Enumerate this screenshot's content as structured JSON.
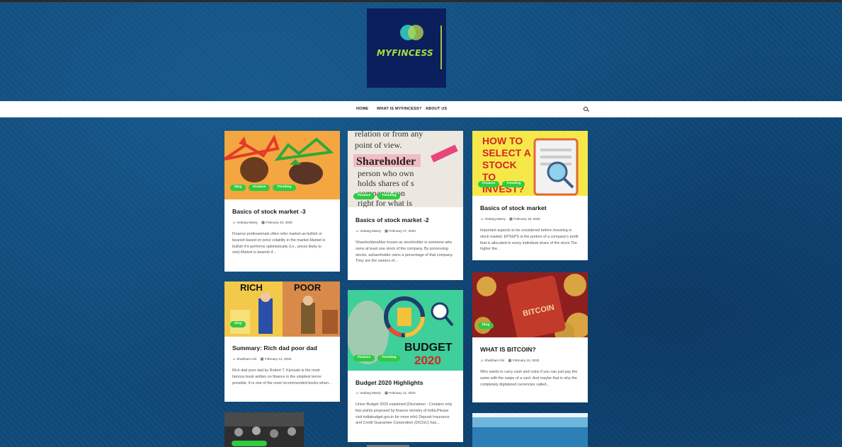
{
  "logo": {
    "text": "MYFINCESS"
  },
  "nav": {
    "items": [
      "HOME",
      "WHAT IS MYFINCESS?",
      "ABOUT US"
    ]
  },
  "posts": [
    {
      "title": "Basics of stock market -3",
      "author": "Vedang Marey",
      "date": "February 23, 2020",
      "tags": [
        "blog",
        "Finance",
        "Trending"
      ],
      "excerpt": "Finance professionals often refer market as bullish or bearish based on price volatility in the market.Market is bullish if it performs optimistically (i.e., prices likely to rise).Market is bearish if...",
      "thumb_colors": [
        "#f4a641",
        "#e6923a"
      ]
    },
    {
      "title": "Basics of stock market -2",
      "author": "Vedang Marey",
      "date": "February 17, 2020",
      "tags": [
        "Finance",
        "Trending"
      ],
      "excerpt": "ShareholdersAlso known as stockholder is someone who owns at least one stock of the company. By processing stocks, ashareholder owns a percentage of that company. They are the owners of...",
      "thumb_colors": [
        "#e9e6df",
        "#d9d4ca"
      ]
    },
    {
      "title": "Basics of stock market",
      "author": "Vedang Marey",
      "date": "February 16, 2020",
      "tags": [
        "Finance",
        "Trending"
      ],
      "excerpt": "Important aspects to be considered before investing in stock market: EPSEPS is the portion of a company's profit that is allocated to every individual share of the stock.The higher the...",
      "thumb_colors": [
        "#f7e84a",
        "#f2d630"
      ]
    },
    {
      "title": "Summary: Rich dad poor dad",
      "author": "Shubham Giri",
      "date": "February 12, 2020",
      "tags": [
        "blog"
      ],
      "excerpt": "Rich dad poor dad by Robert T. Kiyosaki is the most famous book written on finance in the simplest terms possible. It is one of the most recommended books when...",
      "thumb_colors": [
        "#f3c94a",
        "#e39b3f"
      ]
    },
    {
      "title": "Budget 2020 Highlights",
      "author": "Vedang Marey",
      "date": "February 11, 2020",
      "tags": [
        "Finance",
        "Trending"
      ],
      "excerpt": "Union Budget 2020 explained (Disclaimer : Contains only few points proposed by finance ministry of India.Please visit indiabudget.gov.in for more info) Deposit Insurance and Credit Guarantee Corporation (DICGC) has...",
      "thumb_colors": [
        "#3fcf9a",
        "#22b683"
      ]
    },
    {
      "title": "WHAT IS BITCOIN?",
      "author": "Shubham Giri",
      "date": "February 15, 2020",
      "tags": [
        "blog"
      ],
      "excerpt": "Who wants to carry cash and coins if you can just pay the same with the swipe of a card. And maybe that is why the completely digitalized currencies called...",
      "thumb_colors": [
        "#8e1f1f",
        "#c23a2a"
      ]
    }
  ],
  "thumb_text": {
    "stock_select": "HOW TO SELECT A STOCK TO INVEST?",
    "shareholder_line1": "relation or from any",
    "shareholder_line2": "point of view.",
    "shareholder_word": "Shareholder",
    "shareholder_line3": "person who own",
    "shareholder_line4": "holds shares of s",
    "shareholder_line5": "company; son",
    "shareholder_line6": "right for what is",
    "rich": "RICH",
    "poor": "POOR",
    "budget": "BUDGET",
    "budget_year": "2020",
    "bitcoin": "BITCOIN"
  }
}
